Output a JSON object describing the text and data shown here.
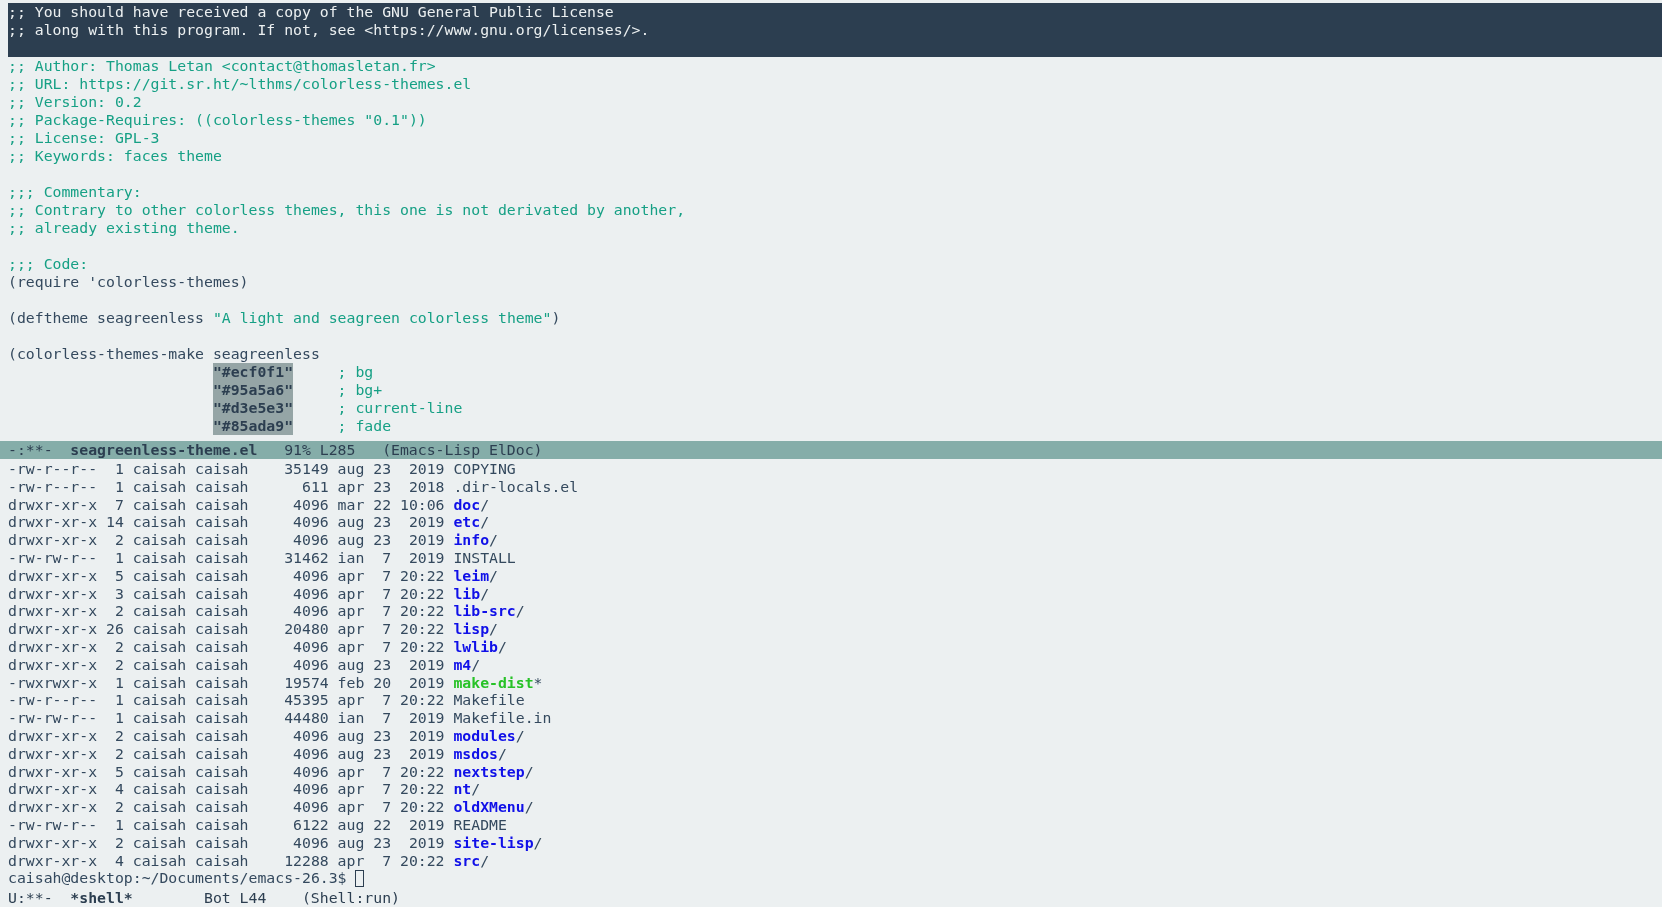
{
  "editor_window": {
    "lines": [
      {
        "kind": "code",
        "highlighted": true,
        "segments": [
          {
            "text": ";; You should have received a copy of the GNU General Public License"
          }
        ]
      },
      {
        "kind": "code",
        "highlighted": true,
        "segments": [
          {
            "text": ";; along with this program. If not, see <https://www.gnu.org/licenses/>."
          }
        ]
      },
      {
        "kind": "blank",
        "highlighted": true
      },
      {
        "kind": "code",
        "highlighted": false,
        "segments": [
          {
            "kind": "comment",
            "text": ";; Author: Thomas Letan <contact@thomasletan.fr>"
          }
        ]
      },
      {
        "kind": "code",
        "highlighted": false,
        "segments": [
          {
            "kind": "comment",
            "text": ";; URL: https://git.sr.ht/~lthms/colorless-themes.el"
          }
        ]
      },
      {
        "kind": "code",
        "highlighted": false,
        "segments": [
          {
            "kind": "comment",
            "text": ";; Version: 0.2"
          }
        ]
      },
      {
        "kind": "code",
        "highlighted": false,
        "segments": [
          {
            "kind": "comment",
            "text": ";; Package-Requires: ((colorless-themes \"0.1\"))"
          }
        ]
      },
      {
        "kind": "code",
        "highlighted": false,
        "segments": [
          {
            "kind": "comment",
            "text": ";; License: GPL-3"
          }
        ]
      },
      {
        "kind": "code",
        "highlighted": false,
        "segments": [
          {
            "kind": "comment",
            "text": ";; Keywords: faces theme"
          }
        ]
      },
      {
        "kind": "blank",
        "highlighted": false
      },
      {
        "kind": "code",
        "highlighted": false,
        "segments": [
          {
            "kind": "comment",
            "text": ";;; Commentary:"
          }
        ]
      },
      {
        "kind": "code",
        "highlighted": false,
        "segments": [
          {
            "kind": "comment",
            "text": ";; Contrary to other colorless themes, this one is not derivated by another,"
          }
        ]
      },
      {
        "kind": "code",
        "highlighted": false,
        "segments": [
          {
            "kind": "comment",
            "text": ";; already existing theme."
          }
        ]
      },
      {
        "kind": "blank",
        "highlighted": false
      },
      {
        "kind": "code",
        "highlighted": false,
        "segments": [
          {
            "kind": "comment",
            "text": ";;; Code:"
          }
        ]
      },
      {
        "kind": "code",
        "highlighted": false,
        "segments": [
          {
            "kind": "plain",
            "text": "(require 'colorless-themes)"
          }
        ]
      },
      {
        "kind": "blank",
        "highlighted": false
      },
      {
        "kind": "code",
        "highlighted": false,
        "segments": [
          {
            "kind": "plain",
            "text": "(deftheme seagreenless "
          },
          {
            "kind": "string",
            "text": "\"A light and seagreen colorless theme\""
          },
          {
            "kind": "plain",
            "text": ")"
          }
        ]
      },
      {
        "kind": "blank",
        "highlighted": false
      },
      {
        "kind": "code",
        "highlighted": false,
        "segments": [
          {
            "kind": "plain",
            "text": "(colorless-themes-make seagreenless"
          }
        ]
      },
      {
        "kind": "color_entry",
        "highlighted": false,
        "value": "\"#ecf0f1\"",
        "comment": "; bg"
      },
      {
        "kind": "color_entry",
        "highlighted": false,
        "value": "\"#95a5a6\"",
        "comment": "; bg+"
      },
      {
        "kind": "color_entry",
        "highlighted": false,
        "value": "\"#d3e5e3\"",
        "comment": "; current-line"
      },
      {
        "kind": "color_entry",
        "highlighted": false,
        "value": "\"#85ada9\"",
        "comment": "; fade"
      }
    ],
    "mode_line": {
      "active": true,
      "status": "-:**-",
      "buffer": "seagreenless-theme.el",
      "position": "91% L285",
      "mode": "(Emacs-Lisp ElDoc)"
    }
  },
  "shell_window": {
    "rows": [
      {
        "info": "-rw-r--r--  1 caisah caisah    35149 aug 23  2019",
        "name": "COPYING",
        "kind": "file"
      },
      {
        "info": "-rw-r--r--  1 caisah caisah      611 apr 23  2018",
        "name": ".dir-locals.el",
        "kind": "file"
      },
      {
        "info": "drwxr-xr-x  7 caisah caisah     4096 mar 22 10:06",
        "name": "doc",
        "suffix": "/",
        "kind": "dir"
      },
      {
        "info": "drwxr-xr-x 14 caisah caisah     4096 aug 23  2019",
        "name": "etc",
        "suffix": "/",
        "kind": "dir"
      },
      {
        "info": "drwxr-xr-x  2 caisah caisah     4096 aug 23  2019",
        "name": "info",
        "suffix": "/",
        "kind": "dir"
      },
      {
        "info": "-rw-rw-r--  1 caisah caisah    31462 ian  7  2019",
        "name": "INSTALL",
        "kind": "file"
      },
      {
        "info": "drwxr-xr-x  5 caisah caisah     4096 apr  7 20:22",
        "name": "leim",
        "suffix": "/",
        "kind": "dir"
      },
      {
        "info": "drwxr-xr-x  3 caisah caisah     4096 apr  7 20:22",
        "name": "lib",
        "suffix": "/",
        "kind": "dir"
      },
      {
        "info": "drwxr-xr-x  2 caisah caisah     4096 apr  7 20:22",
        "name": "lib-src",
        "suffix": "/",
        "kind": "dir"
      },
      {
        "info": "drwxr-xr-x 26 caisah caisah    20480 apr  7 20:22",
        "name": "lisp",
        "suffix": "/",
        "kind": "dir"
      },
      {
        "info": "drwxr-xr-x  2 caisah caisah     4096 apr  7 20:22",
        "name": "lwlib",
        "suffix": "/",
        "kind": "dir"
      },
      {
        "info": "drwxr-xr-x  2 caisah caisah     4096 aug 23  2019",
        "name": "m4",
        "suffix": "/",
        "kind": "dir"
      },
      {
        "info": "-rwxrwxr-x  1 caisah caisah    19574 feb 20  2019",
        "name": "make-dist",
        "suffix": "*",
        "kind": "exec"
      },
      {
        "info": "-rw-r--r--  1 caisah caisah    45395 apr  7 20:22",
        "name": "Makefile",
        "kind": "file"
      },
      {
        "info": "-rw-rw-r--  1 caisah caisah    44480 ian  7  2019",
        "name": "Makefile.in",
        "kind": "file"
      },
      {
        "info": "drwxr-xr-x  2 caisah caisah     4096 aug 23  2019",
        "name": "modules",
        "suffix": "/",
        "kind": "dir"
      },
      {
        "info": "drwxr-xr-x  2 caisah caisah     4096 aug 23  2019",
        "name": "msdos",
        "suffix": "/",
        "kind": "dir"
      },
      {
        "info": "drwxr-xr-x  5 caisah caisah     4096 apr  7 20:22",
        "name": "nextstep",
        "suffix": "/",
        "kind": "dir"
      },
      {
        "info": "drwxr-xr-x  4 caisah caisah     4096 apr  7 20:22",
        "name": "nt",
        "suffix": "/",
        "kind": "dir"
      },
      {
        "info": "drwxr-xr-x  2 caisah caisah     4096 apr  7 20:22",
        "name": "oldXMenu",
        "suffix": "/",
        "kind": "dir"
      },
      {
        "info": "-rw-rw-r--  1 caisah caisah     6122 aug 22  2019",
        "name": "README",
        "kind": "file"
      },
      {
        "info": "drwxr-xr-x  2 caisah caisah     4096 aug 23  2019",
        "name": "site-lisp",
        "suffix": "/",
        "kind": "dir"
      },
      {
        "info": "drwxr-xr-x  4 caisah caisah    12288 apr  7 20:22",
        "name": "src",
        "suffix": "/",
        "kind": "dir"
      }
    ],
    "prompt": {
      "text": "caisah@desktop:~/Documents/emacs-26.3$",
      "cursor": true
    },
    "mode_line": {
      "active": false,
      "status": "U:**-",
      "buffer": "*shell*",
      "position": "Bot L44",
      "mode": "(Shell:run)"
    }
  }
}
